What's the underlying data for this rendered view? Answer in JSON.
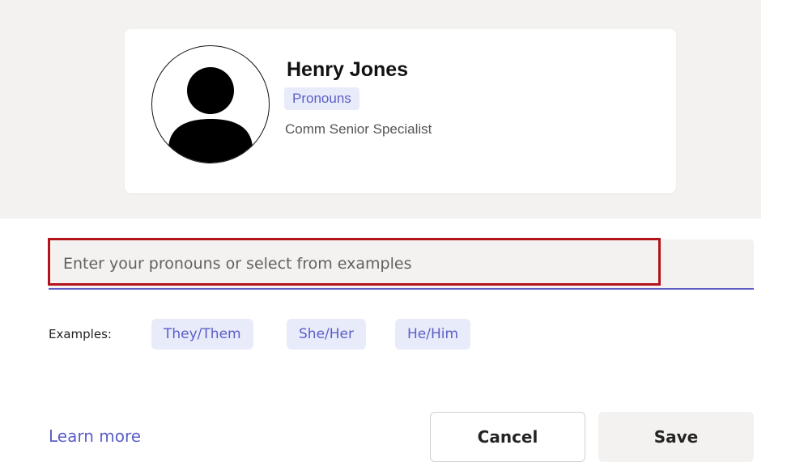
{
  "profile": {
    "name": "Henry Jones",
    "pronouns_tag": "Pronouns",
    "job_title": "Comm Senior Specialist",
    "avatar_icon": "person-avatar-icon"
  },
  "pronoun_field": {
    "placeholder": "Enter your pronouns or select from examples",
    "value": ""
  },
  "examples": {
    "label": "Examples:",
    "options": [
      "They/Them",
      "She/Her",
      "He/Him"
    ]
  },
  "footer": {
    "learn_more": "Learn more",
    "cancel_label": "Cancel",
    "save_label": "Save"
  },
  "colors": {
    "accent": "#5b5fc7",
    "chip_background": "#e8ebfa",
    "highlight_border": "#b3141c",
    "panel_background": "#f3f2f1"
  }
}
